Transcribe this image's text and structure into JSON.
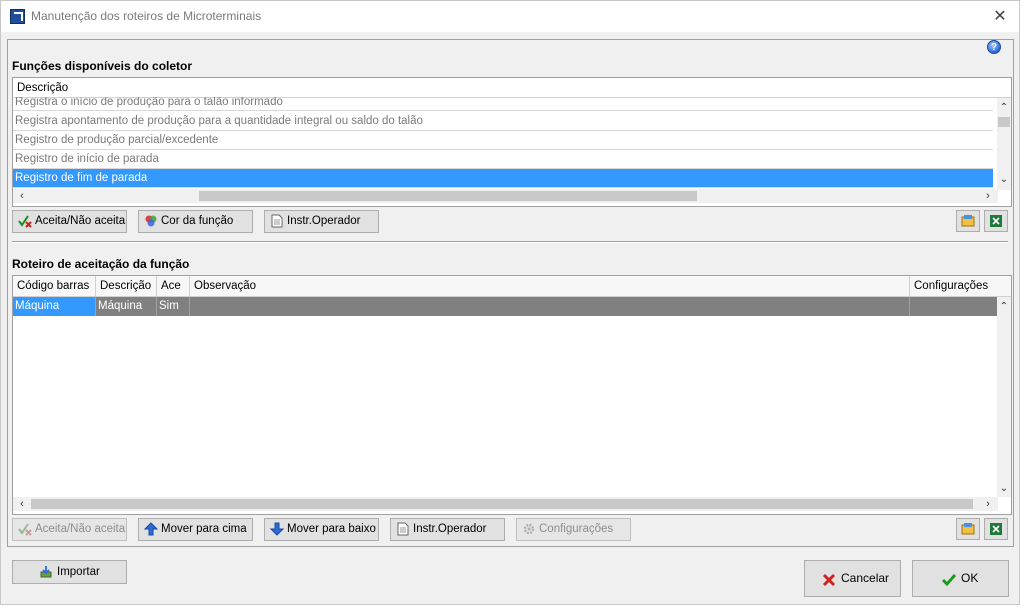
{
  "window": {
    "title": "Manutenção dos roteiros de Microterminais",
    "close_label": "✕"
  },
  "help_icon_glyph": "?",
  "functions_section": {
    "title": "Funções disponíveis do coletor",
    "column_header": "Descrição",
    "rows": [
      "Registra o início de produção para o talão informado",
      "Registra apontamento de produção para a quantidade integral ou saldo do talão",
      "Registro de produção parcial/excedente",
      "Registro de início de parada",
      "Registro de fim de parada"
    ],
    "selected_index": 4,
    "buttons": {
      "accept": "Aceita/Não aceita",
      "color": "Cor da função",
      "instr": "Instr.Operador"
    }
  },
  "route_section": {
    "title": "Roteiro de aceitação da função",
    "columns": [
      "Código barras",
      "Descrição",
      "Ace",
      "Observação",
      "Configurações"
    ],
    "rows": [
      [
        "Máquina",
        "Máquina",
        "Sim",
        "",
        ""
      ]
    ],
    "buttons": {
      "accept": "Aceita/Não aceita",
      "move_up": "Mover para cima",
      "move_down": "Mover para baixo",
      "instr": "Instr.Operador",
      "config": "Configurações"
    }
  },
  "footer": {
    "import": "Importar",
    "cancel": "Cancelar",
    "ok": "OK"
  },
  "colors": {
    "selection": "#3399ff",
    "selected_row_dark": "#808080"
  }
}
